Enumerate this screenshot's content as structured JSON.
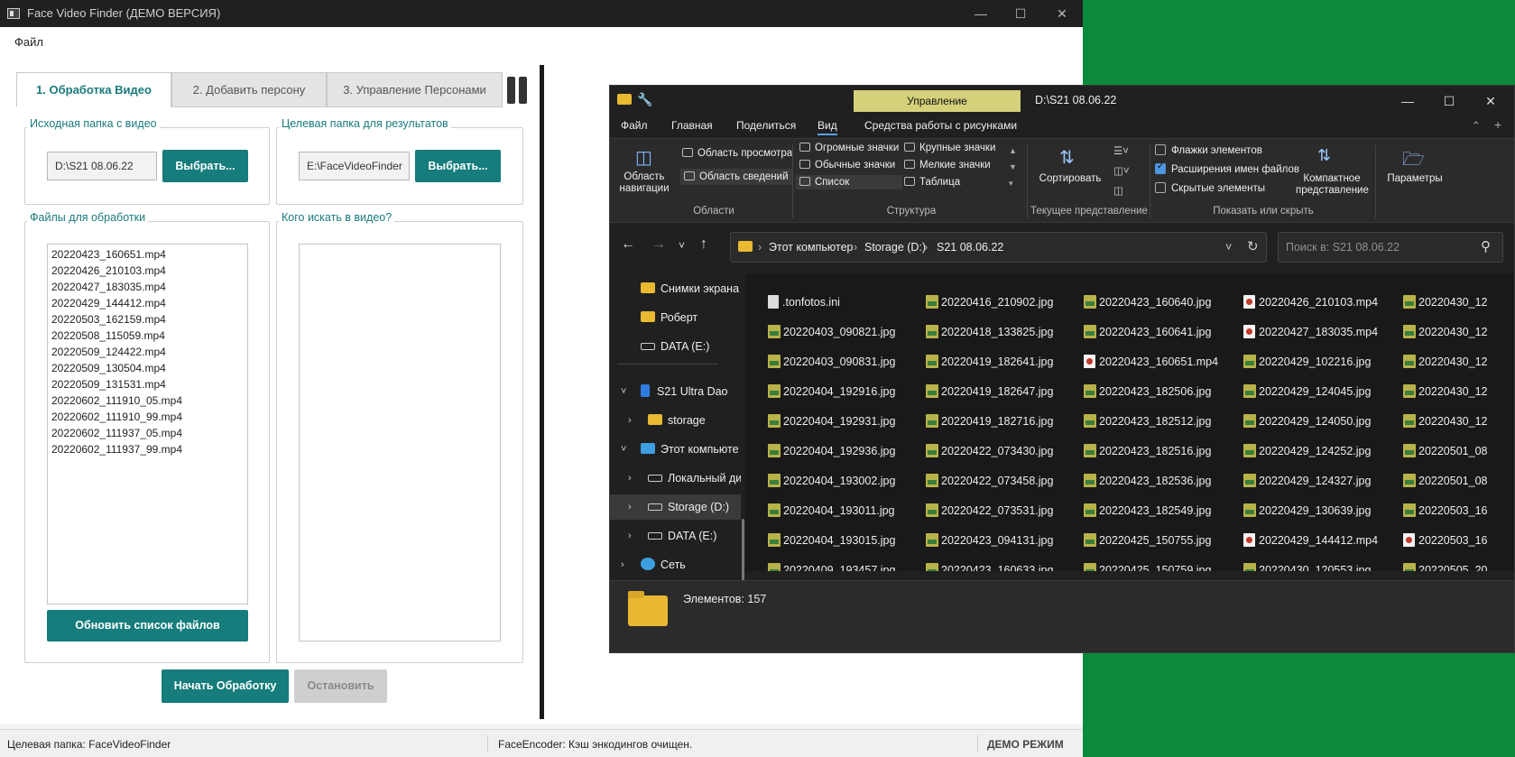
{
  "app": {
    "title": "Face Video Finder (ДЕМО ВЕРСИЯ)",
    "menu": [
      "Файл"
    ],
    "tabs": [
      "1. Обработка Видео",
      "2. Добавить персону",
      "3. Управление Персонами"
    ],
    "source_group": {
      "label": "Исходная папка с видео",
      "value": "D:\\S21 08.06.22",
      "button": "Выбрать..."
    },
    "target_group": {
      "label": "Целевая папка для результатов",
      "value": "E:\\FaceVideoFinder",
      "button": "Выбрать..."
    },
    "files_group": {
      "label": "Файлы для обработки",
      "files": [
        "20220423_160651.mp4",
        "20220426_210103.mp4",
        "20220427_183035.mp4",
        "20220429_144412.mp4",
        "20220503_162159.mp4",
        "20220508_115059.mp4",
        "20220509_124422.mp4",
        "20220509_130504.mp4",
        "20220509_131531.mp4",
        "20220602_111910_05.mp4",
        "20220602_111910_99.mp4",
        "20220602_111937_05.mp4",
        "20220602_111937_99.mp4"
      ],
      "refresh_button": "Обновить список файлов"
    },
    "persons_group": {
      "label": "Кого искать в видео?"
    },
    "start_button": "Начать Обработку",
    "stop_button": "Остановить",
    "status": {
      "left": "Целевая папка: FaceVideoFinder",
      "middle": "FaceEncoder: Кэш энкодингов очищен.",
      "right": "ДЕМО РЕЖИМ"
    },
    "accent_color": "#167c7c"
  },
  "explorer": {
    "manage_tab": "Управление",
    "title_path": "D:\\S21 08.06.22",
    "tabs": [
      "Файл",
      "Главная",
      "Поделиться",
      "Вид",
      "Средства работы с рисунками"
    ],
    "active_tab": "Вид",
    "ribbon": {
      "nav_pane": "Область навигации",
      "preview_pane": "Область просмотра",
      "details_pane": "Область сведений",
      "group_panes": "Области",
      "huge_icons": "Огромные значки",
      "large_icons": "Крупные значки",
      "normal_icons": "Обычные значки",
      "small_icons": "Мелкие значки",
      "list": "Список",
      "table": "Таблица",
      "group_layout": "Структура",
      "sort": "Сортировать",
      "group_current": "Текущее представление",
      "item_checkboxes": "Флажки элементов",
      "file_extensions": "Расширения имен файлов",
      "hidden_items": "Скрытые элементы",
      "compact": "Компактное представление",
      "group_show": "Показать или скрыть",
      "options": "Параметры"
    },
    "breadcrumb": [
      "Этот компьютер",
      "Storage (D:)",
      "S21 08.06.22"
    ],
    "search_placeholder": "Поиск в: S21 08.06.22",
    "nav": [
      "Снимки экрана",
      "Роберт",
      "DATA (E:)",
      "S21 Ultra Dao",
      "storage",
      "Этот компьюте",
      "Локальный ди",
      "Storage (D:)",
      "DATA (E:)",
      "Сеть"
    ],
    "columns": [
      [
        ".tonfotos.ini",
        "20220403_090821.jpg",
        "20220403_090831.jpg",
        "20220404_192916.jpg",
        "20220404_192931.jpg",
        "20220404_192936.jpg",
        "20220404_193002.jpg",
        "20220404_193011.jpg",
        "20220404_193015.jpg",
        "20220409_193457.jpg"
      ],
      [
        "20220416_210902.jpg",
        "20220418_133825.jpg",
        "20220419_182641.jpg",
        "20220419_182647.jpg",
        "20220419_182716.jpg",
        "20220422_073430.jpg",
        "20220422_073458.jpg",
        "20220422_073531.jpg",
        "20220423_094131.jpg",
        "20220423_160633.jpg"
      ],
      [
        "20220423_160640.jpg",
        "20220423_160641.jpg",
        "20220423_160651.mp4",
        "20220423_182506.jpg",
        "20220423_182512.jpg",
        "20220423_182516.jpg",
        "20220423_182536.jpg",
        "20220423_182549.jpg",
        "20220425_150755.jpg",
        "20220425_150759.jpg"
      ],
      [
        "20220426_210103.mp4",
        "20220427_183035.mp4",
        "20220429_102216.jpg",
        "20220429_124045.jpg",
        "20220429_124050.jpg",
        "20220429_124252.jpg",
        "20220429_124327.jpg",
        "20220429_130639.jpg",
        "20220429_144412.mp4",
        "20220430_120553.jpg"
      ],
      [
        "20220430_12",
        "20220430_12",
        "20220430_12",
        "20220430_12",
        "20220430_12",
        "20220501_08",
        "20220501_08",
        "20220503_16",
        "20220503_16",
        "20220505_20"
      ]
    ],
    "column_types": [
      [
        "ini",
        "jpg",
        "jpg",
        "jpg",
        "jpg",
        "jpg",
        "jpg",
        "jpg",
        "jpg",
        "jpg"
      ],
      [
        "jpg",
        "jpg",
        "jpg",
        "jpg",
        "jpg",
        "jpg",
        "jpg",
        "jpg",
        "jpg",
        "jpg"
      ],
      [
        "jpg",
        "jpg",
        "mp4",
        "jpg",
        "jpg",
        "jpg",
        "jpg",
        "jpg",
        "jpg",
        "jpg"
      ],
      [
        "mp4",
        "mp4",
        "jpg",
        "jpg",
        "jpg",
        "jpg",
        "jpg",
        "jpg",
        "mp4",
        "jpg"
      ],
      [
        "jpg",
        "jpg",
        "jpg",
        "jpg",
        "jpg",
        "jpg",
        "jpg",
        "jpg",
        "mp4",
        "jpg"
      ]
    ],
    "details_count": "Элементов: 157"
  }
}
